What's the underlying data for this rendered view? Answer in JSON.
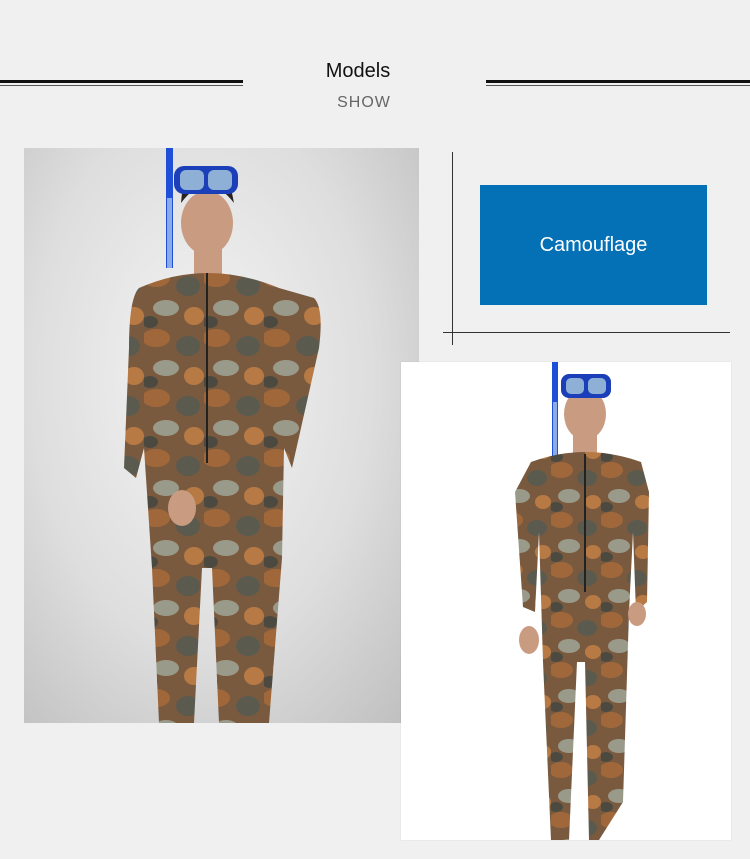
{
  "header": {
    "title": "Models",
    "subtitle": "SHOW"
  },
  "product": {
    "color_label": "Camouflage",
    "label_color": "#0470b6"
  },
  "images": {
    "left_photo": "model-front-camouflage-suit",
    "right_photo": "model-standing-camouflage-suit"
  }
}
